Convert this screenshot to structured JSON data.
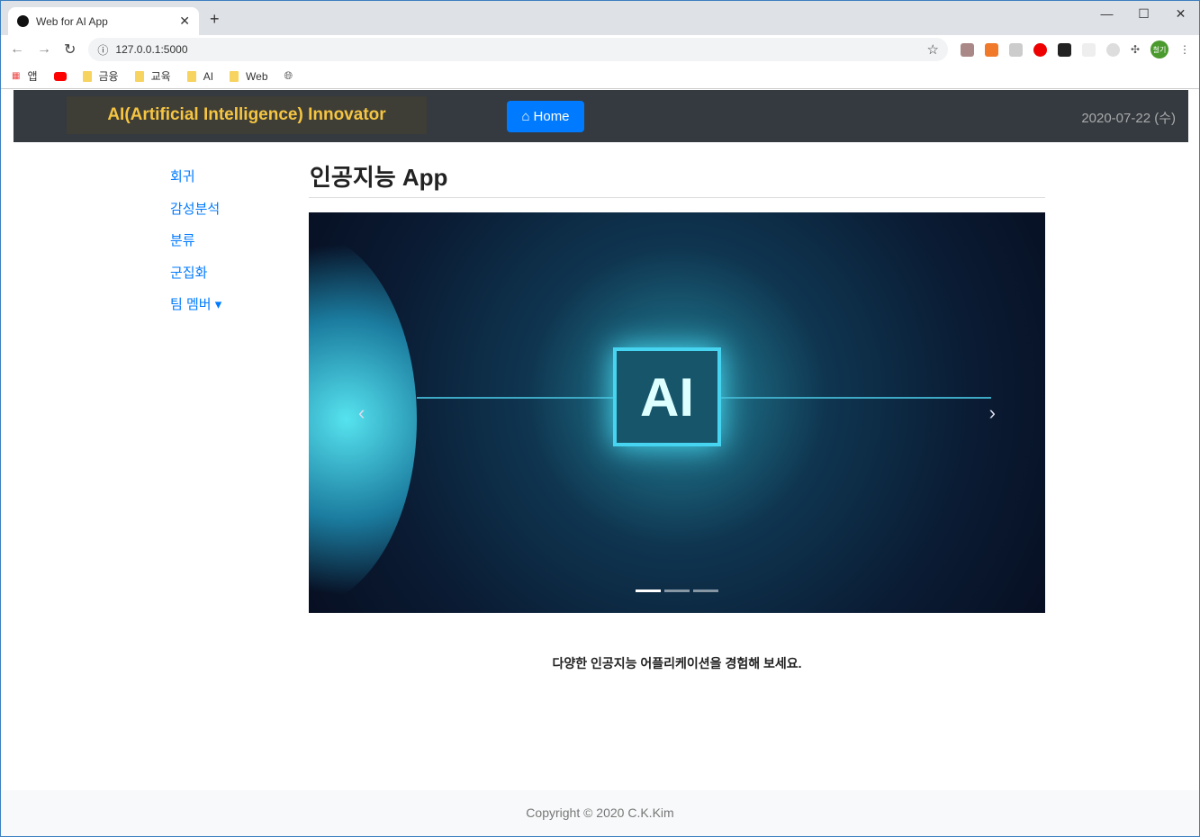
{
  "browser": {
    "tab_title": "Web for AI App",
    "url": "127.0.0.1:5000",
    "bookmarks": [
      {
        "label": "앱"
      },
      {
        "label": ""
      },
      {
        "label": "금융"
      },
      {
        "label": "교육"
      },
      {
        "label": "AI"
      },
      {
        "label": "Web"
      }
    ],
    "profile": "철기"
  },
  "navbar": {
    "brand": "AI(Artificial Intelligence) Innovator",
    "home": "Home",
    "date": "2020-07-22 (수)"
  },
  "sidebar": {
    "items": [
      {
        "label": "회귀"
      },
      {
        "label": "감성분석"
      },
      {
        "label": "분류"
      },
      {
        "label": "군집화"
      },
      {
        "label": "팀 멤버 ▾"
      }
    ]
  },
  "main": {
    "title": "인공지능 App",
    "carousel": {
      "slide_text": "AI",
      "slides": 3,
      "active": 1
    },
    "caption": "다양한 인공지능 어플리케이션을 경험해 보세요."
  },
  "footer": {
    "text": "Copyright © 2020 C.K.Kim"
  }
}
